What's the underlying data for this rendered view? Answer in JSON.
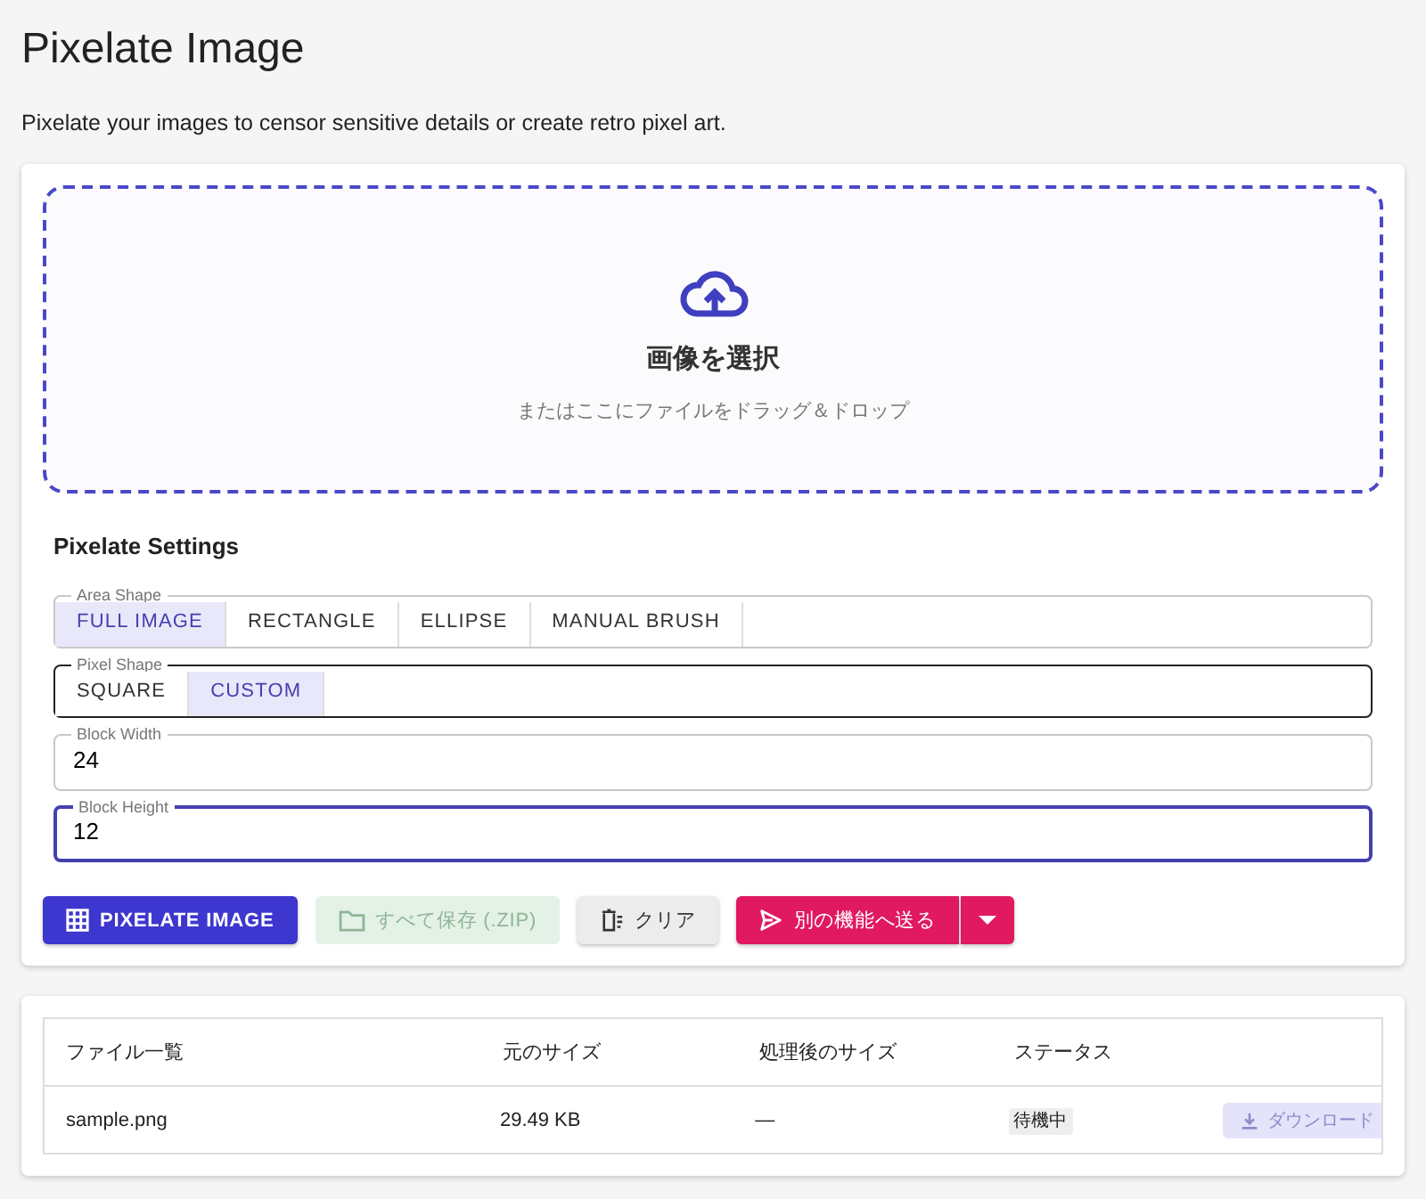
{
  "page": {
    "title": "Pixelate Image",
    "subtitle": "Pixelate your images to censor sensitive details or create retro pixel art."
  },
  "dropzone": {
    "title": "画像を選択",
    "hint": "またはここにファイルをドラッグ＆ドロップ"
  },
  "settings": {
    "title": "Pixelate Settings",
    "groups": [
      {
        "kind": "toggle",
        "label": "Area Shape",
        "hovered": false,
        "options": [
          {
            "label": "FULL IMAGE",
            "selected": true
          },
          {
            "label": "RECTANGLE",
            "selected": false
          },
          {
            "label": "ELLIPSE",
            "selected": false
          },
          {
            "label": "MANUAL BRUSH",
            "selected": false
          }
        ]
      },
      {
        "kind": "toggle",
        "label": "Pixel Shape",
        "hovered": true,
        "options": [
          {
            "label": "SQUARE",
            "selected": false
          },
          {
            "label": "CUSTOM",
            "selected": true
          }
        ]
      },
      {
        "kind": "number",
        "label": "Block Width",
        "value": "24",
        "focused": false
      },
      {
        "kind": "number",
        "label": "Block Height",
        "value": "12",
        "focused": true
      }
    ]
  },
  "actions": [
    {
      "kind": "primary",
      "label": "PIXELATE IMAGE",
      "disabled": false,
      "has_menu": false
    },
    {
      "kind": "success",
      "label": "すべて保存 (.ZIP)",
      "disabled": true,
      "has_menu": false
    },
    {
      "kind": "neutral",
      "label": "クリア",
      "disabled": false,
      "has_menu": false
    },
    {
      "kind": "accent",
      "label": "別の機能へ送る",
      "disabled": false,
      "has_menu": true
    }
  ],
  "table": {
    "columns": [
      "ファイル一覧",
      "元のサイズ",
      "処理後のサイズ",
      "ステータス"
    ],
    "rows": [
      {
        "file": "sample.png",
        "original_size": "29.49 KB",
        "processed_size": "—",
        "status": "待機中",
        "download": {
          "label": "ダウンロード",
          "disabled": true
        }
      }
    ]
  }
}
